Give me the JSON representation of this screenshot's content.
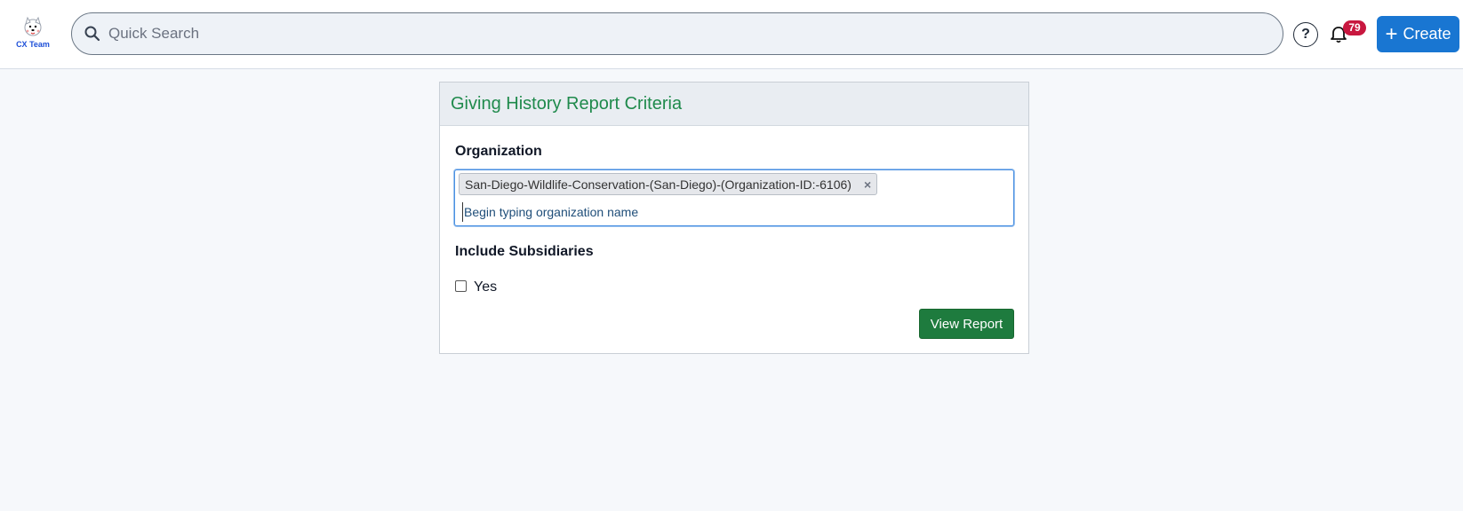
{
  "header": {
    "logo_text": "CX Team",
    "search_placeholder": "Quick Search",
    "help_label": "?",
    "notifications_count": "79",
    "create_label": "Create"
  },
  "report": {
    "title": "Giving History Report Criteria",
    "organization_label": "Organization",
    "selected_organization": "San-Diego-Wildlife-Conservation-(San-Diego)-(Organization-ID:-6106)",
    "chip_remove": "×",
    "organization_placeholder": "Begin typing organization name",
    "subsidiaries_label": "Include Subsidiaries",
    "subsidiaries_option": "Yes",
    "subsidiaries_checked": false,
    "submit_label": "View Report"
  },
  "colors": {
    "accent_blue": "#1976d2",
    "title_green": "#1f8a4c",
    "button_green": "#1e7b3e",
    "badge_red": "#c8173f"
  }
}
